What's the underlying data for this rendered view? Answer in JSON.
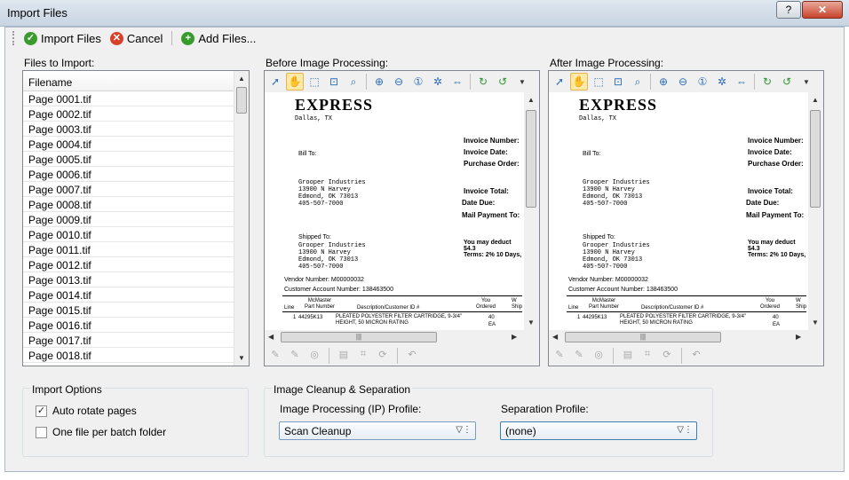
{
  "window": {
    "title": "Import Files",
    "help_label": "?",
    "close_label": "✕"
  },
  "toolbar": {
    "import_label": "Import Files",
    "cancel_label": "Cancel",
    "add_label": "Add Files..."
  },
  "files": {
    "section_label": "Files to Import:",
    "column_header": "Filename",
    "items": [
      "Page 0001.tif",
      "Page 0002.tif",
      "Page 0003.tif",
      "Page 0004.tif",
      "Page 0005.tif",
      "Page 0006.tif",
      "Page 0007.tif",
      "Page 0008.tif",
      "Page 0009.tif",
      "Page 0010.tif",
      "Page 0011.tif",
      "Page 0012.tif",
      "Page 0013.tif",
      "Page 0014.tif",
      "Page 0015.tif",
      "Page 0016.tif",
      "Page 0017.tif",
      "Page 0018.tif"
    ]
  },
  "before": {
    "label": "Before Image Processing:"
  },
  "after": {
    "label": "After Image Processing:"
  },
  "document": {
    "logo": "EXPRESS",
    "city": "Dallas, TX",
    "bill_to": "Bill To:",
    "company": "Grooper Industries",
    "street": "13900 N Harvey",
    "citystate": "Edmond, OK 73013",
    "phone": "405-507-7000",
    "shipped_to": "Shipped To:",
    "invoice_number": "Invoice Number:",
    "invoice_date": "Invoice Date:",
    "purchase_order": "Purchase Order:",
    "invoice_total": "Invoice Total:",
    "date_due": "Date Due:",
    "mail_payment": "Mail Payment To:",
    "deduct": "You may deduct $4.3",
    "terms": "Terms: 2% 10 Days,",
    "vendor": "Vendor Number:  M00000032",
    "customer": "Customer Account Number:  138463500",
    "col_line": "Line",
    "col_part": "McMaster Part Number",
    "col_desc": "Description/Customer ID #",
    "col_ordered": "You Ordered",
    "col_ship": "W Ship",
    "row_line": "1",
    "row_part": "44295K13",
    "row_desc": "PLEATED POLYESTER FILTER CARTRIDGE, 9-3/4\" HEIGHT, 50 MICRON RATING",
    "row_qty": "40",
    "row_unit": "EA"
  },
  "import_options": {
    "title": "Import Options",
    "auto_rotate": "Auto rotate pages",
    "auto_rotate_checked": true,
    "one_file": "One file per batch folder",
    "one_file_checked": false
  },
  "cleanup": {
    "title": "Image Cleanup & Separation",
    "ip_label": "Image Processing (IP) Profile:",
    "ip_value": "Scan Cleanup",
    "sep_label": "Separation Profile:",
    "sep_value": "(none)"
  }
}
